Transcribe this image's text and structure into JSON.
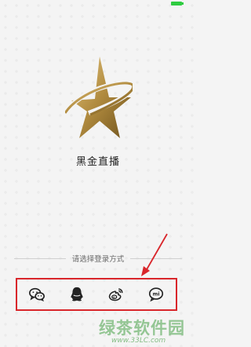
{
  "app": {
    "name": "黑金直播"
  },
  "login": {
    "prompt": "请选择登录方式",
    "options": [
      {
        "id": "wechat",
        "icon": "wechat-icon"
      },
      {
        "id": "qq",
        "icon": "qq-icon"
      },
      {
        "id": "weibo",
        "icon": "weibo-icon"
      },
      {
        "id": "mi",
        "icon": "mi-icon"
      }
    ]
  },
  "watermark": {
    "brand": "绿茶软件园",
    "url": "www.33LC.com"
  },
  "colors": {
    "logo_gold": "#b08a3e",
    "highlight": "#d9262b",
    "watermark": "#46a046",
    "status_battery": "#2ecc40"
  }
}
